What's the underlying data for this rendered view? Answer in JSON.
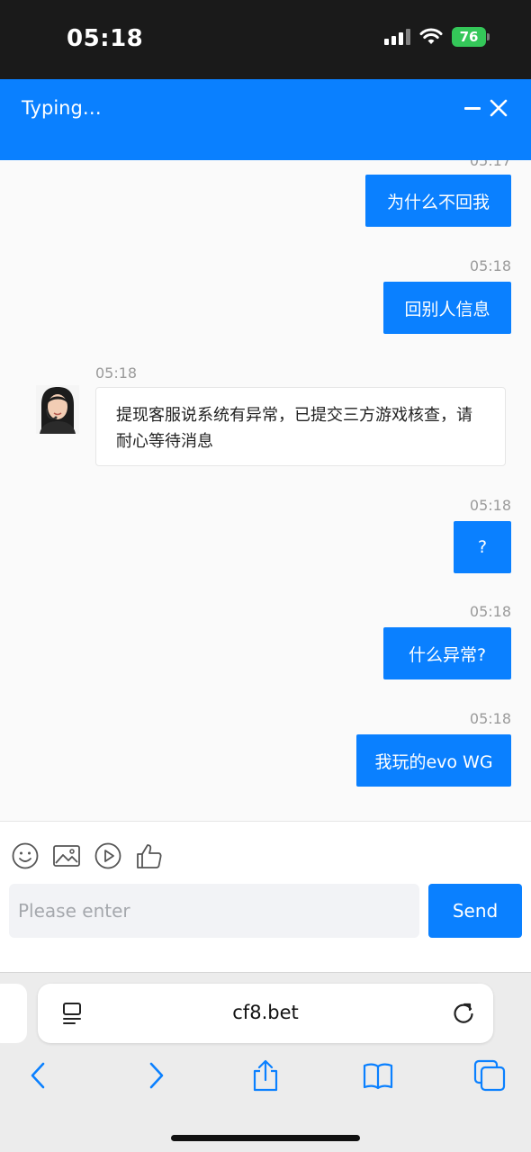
{
  "status_bar": {
    "time": "05:18",
    "battery": "76"
  },
  "chat_header": {
    "title": "Typing…"
  },
  "messages": {
    "top_partial_time": "05:17",
    "items": [
      {
        "direction": "outgoing",
        "time": "",
        "text": "为什么不回我"
      },
      {
        "direction": "outgoing",
        "time": "05:18",
        "text": "回别人信息"
      },
      {
        "direction": "incoming",
        "time": "05:18",
        "text": "提现客服说系统有异常，已提交三方游戏核查，请耐心等待消息"
      },
      {
        "direction": "outgoing",
        "time": "05:18",
        "text": "?"
      },
      {
        "direction": "outgoing",
        "time": "05:18",
        "text": "什么异常?"
      },
      {
        "direction": "outgoing",
        "time": "05:18",
        "text": "我玩的evo WG"
      }
    ]
  },
  "composer": {
    "tools": [
      "emoji-icon",
      "image-icon",
      "video-icon",
      "thumbs-up-icon"
    ],
    "placeholder": "Please enter",
    "send_label": "Send"
  },
  "browser": {
    "url": "cf8.bet",
    "nav_icons": [
      "back-icon",
      "forward-icon",
      "share-icon",
      "bookmarks-icon",
      "tabs-icon"
    ]
  },
  "colors": {
    "accent": "#0a80ff",
    "battery": "#34c759"
  }
}
